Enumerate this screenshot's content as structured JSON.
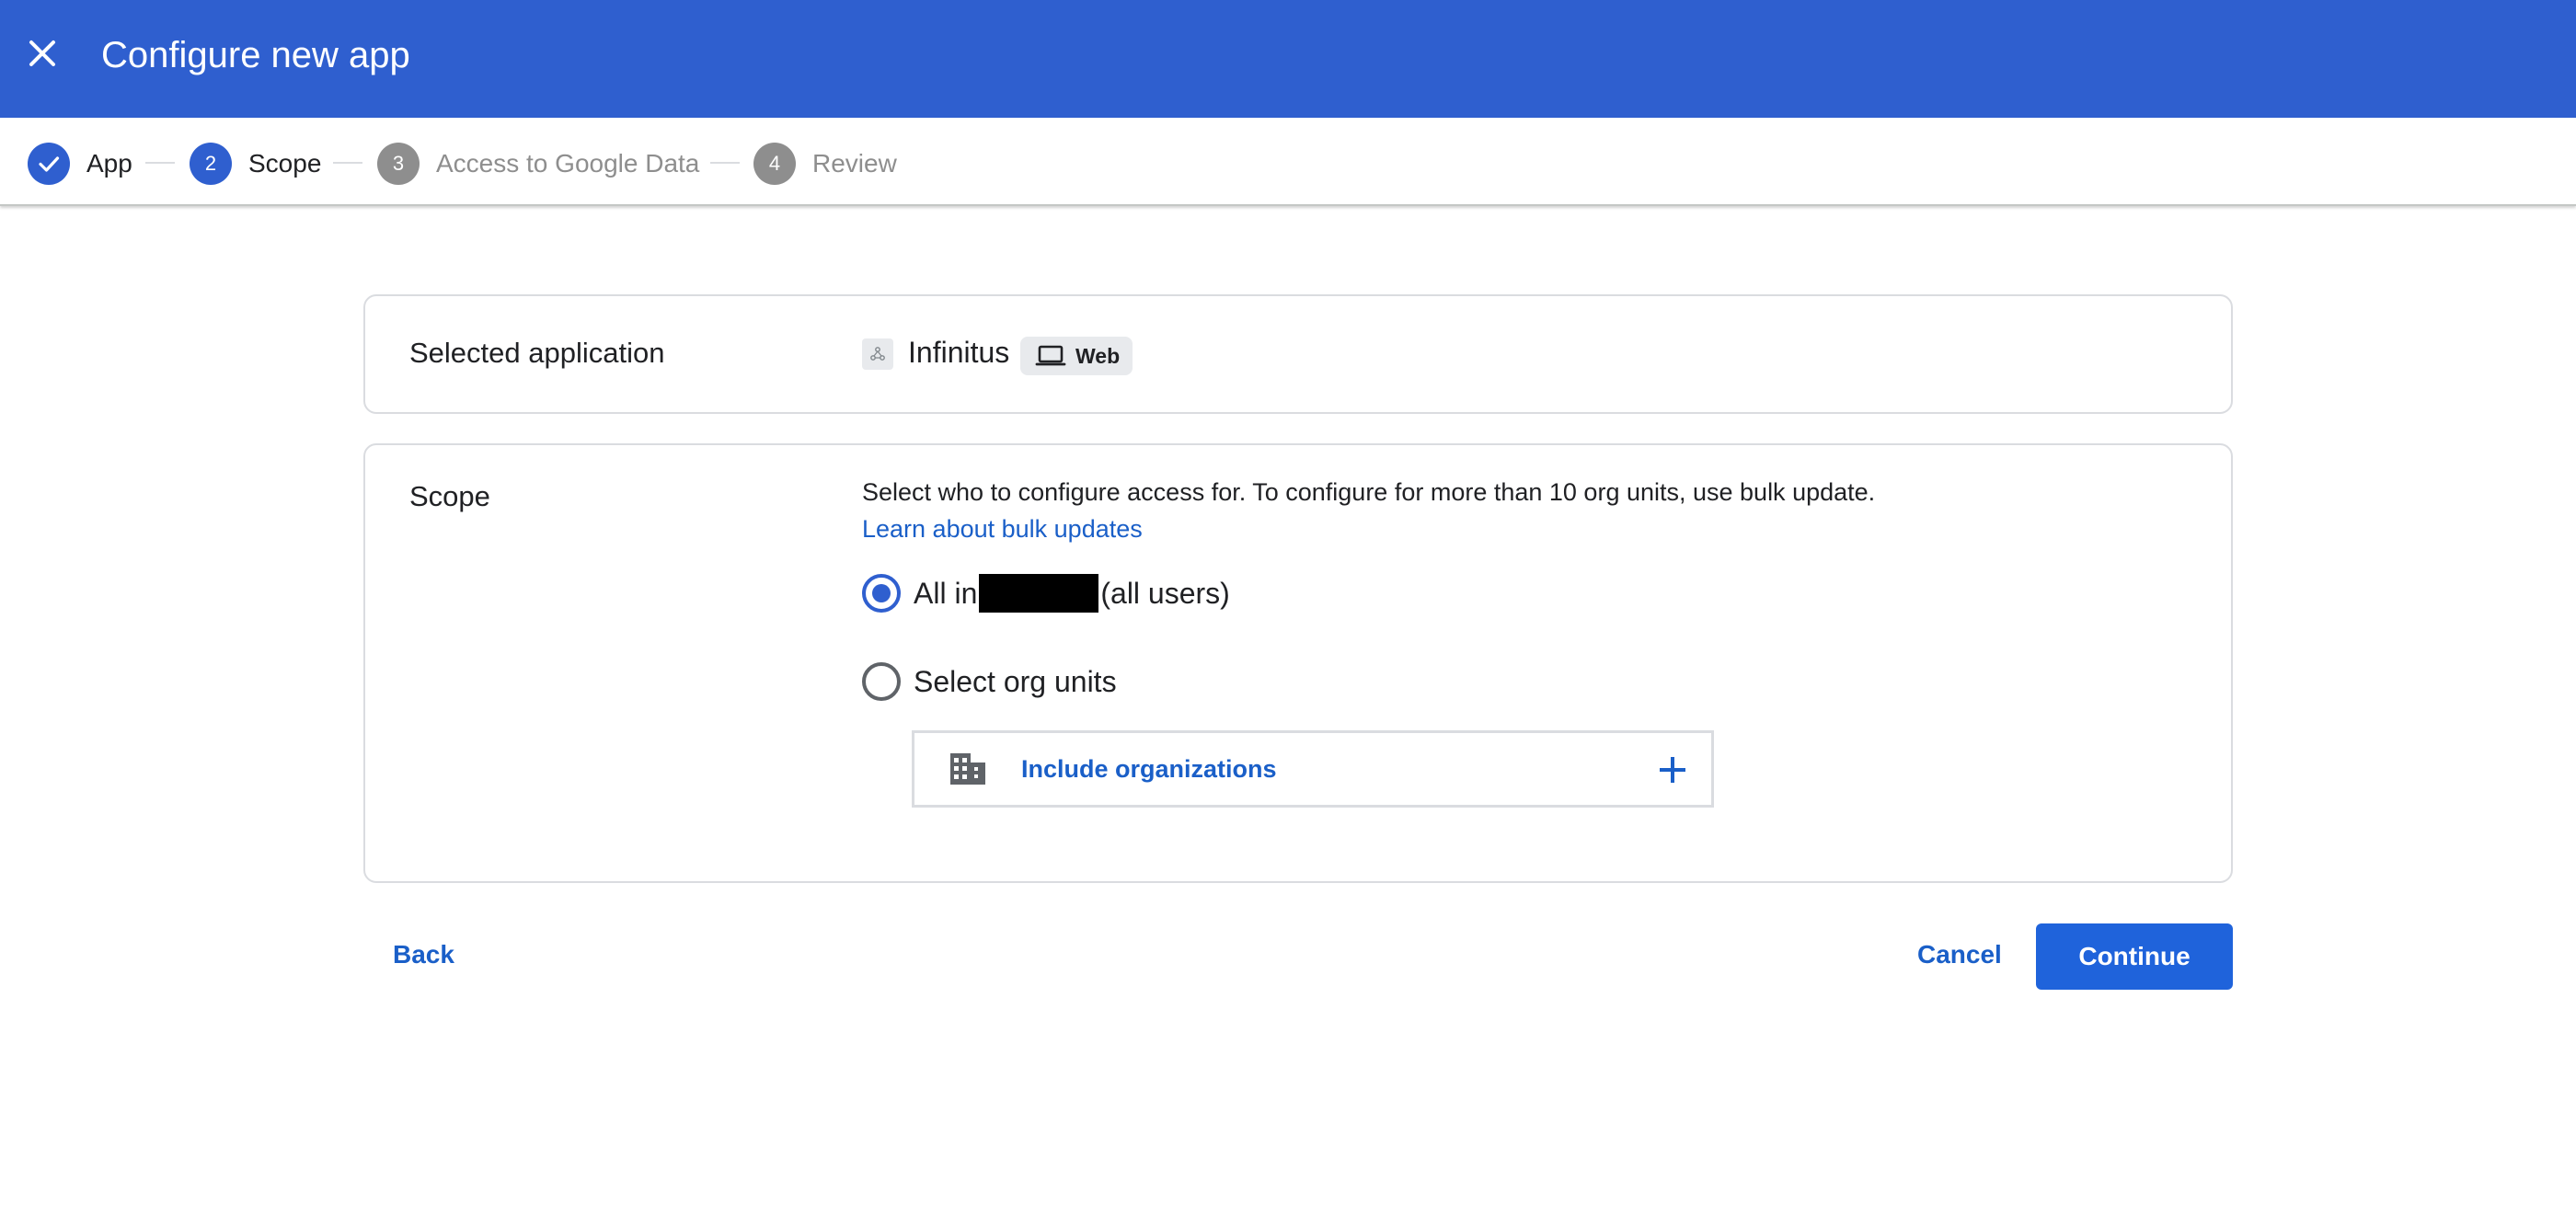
{
  "header": {
    "title": "Configure new app",
    "close_icon": "close-icon",
    "background_color": "#2f5fcf"
  },
  "stepper": {
    "steps": [
      {
        "number": "1",
        "label": "App",
        "state": "done",
        "icon": "check-icon"
      },
      {
        "number": "2",
        "label": "Scope",
        "state": "current"
      },
      {
        "number": "3",
        "label": "Access to Google Data",
        "state": "pending"
      },
      {
        "number": "4",
        "label": "Review",
        "state": "pending"
      }
    ]
  },
  "selected_application": {
    "heading": "Selected application",
    "app_name": "Infinitus",
    "app_icon": "app-logo-icon",
    "platform_chip": "Web",
    "platform_icon": "laptop-icon"
  },
  "scope": {
    "heading": "Scope",
    "description": "Select who to configure access for. To configure for more than 10 org units, use bulk update.",
    "learn_link": "Learn about bulk updates",
    "options": [
      {
        "prefix": "All in",
        "suffix": "(all users)",
        "selected": true,
        "redacted": true
      },
      {
        "label": "Select org units",
        "selected": false
      }
    ],
    "include_orgs": {
      "label": "Include organizations",
      "icon": "building-icon",
      "action_icon": "plus-icon"
    }
  },
  "footer": {
    "back": "Back",
    "cancel": "Cancel",
    "continue": "Continue",
    "accent_color": "#1f63db"
  }
}
